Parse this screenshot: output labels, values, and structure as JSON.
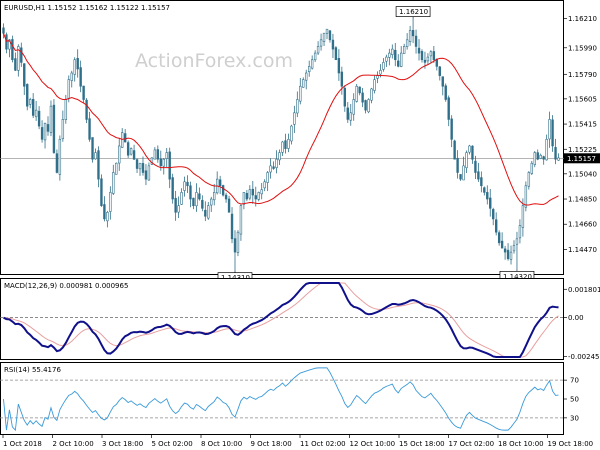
{
  "header": {
    "main": "EURUSD,H1  1.15152 1.15162 1.15122 1.15157",
    "macd": "MACD(12,26,9) 0.000981 0.000965",
    "rsi": "RSI(14) 55.4176"
  },
  "watermark": "ActionForex.com",
  "colors": {
    "candle": "#2f6f8a",
    "ma": "#e01010",
    "macd_line": "#10108a",
    "macd_signal": "#e8a0a0",
    "rsi_line": "#3a9ad9",
    "grid_dash": "#999999",
    "current_price_line": "#888888"
  },
  "chart_data": [
    {
      "type": "candlestick",
      "symbol": "EURUSD",
      "timeframe": "H1",
      "ylim": [
        1.143,
        1.1632
      ],
      "y_ticks": [
        "1.16210",
        "1.15990",
        "1.15790",
        "1.15605",
        "1.15415",
        "1.15225",
        "1.15157",
        "1.15040",
        "1.14850",
        "1.14660",
        "1.14470"
      ],
      "current_price": "1.15157",
      "annotations": [
        {
          "label": "1.16210",
          "value": 1.1621,
          "index": 138
        },
        {
          "label": "1.14310",
          "value": 1.1431,
          "index": 78
        },
        {
          "label": "1.14320",
          "value": 1.1432,
          "index": 173
        }
      ],
      "x_labels": [
        "1 Oct 2018",
        "2 Oct 10:00",
        "3 Oct 18:00",
        "5 Oct 02:00",
        "8 Oct 10:00",
        "9 Oct 18:00",
        "11 Oct 02:00",
        "12 Oct 10:00",
        "15 Oct 18:00",
        "17 Oct 02:00",
        "18 Oct 10:00",
        "19 Oct 18:00"
      ],
      "closes": [
        1.161,
        1.1598,
        1.1605,
        1.159,
        1.1582,
        1.16,
        1.1588,
        1.157,
        1.1555,
        1.156,
        1.1548,
        1.1552,
        1.154,
        1.153,
        1.1542,
        1.1536,
        1.1555,
        1.152,
        1.1505,
        1.153,
        1.1545,
        1.156,
        1.1575,
        1.158,
        1.159,
        1.1583,
        1.157,
        1.156,
        1.1545,
        1.153,
        1.1515,
        1.152,
        1.15,
        1.148,
        1.147,
        1.1475,
        1.149,
        1.1505,
        1.1512,
        1.1525,
        1.1535,
        1.1528,
        1.1518,
        1.1523,
        1.1515,
        1.1508,
        1.1512,
        1.1505,
        1.15,
        1.151,
        1.1516,
        1.1522,
        1.1515,
        1.151,
        1.1515,
        1.152,
        1.15,
        1.1485,
        1.1475,
        1.148,
        1.149,
        1.1498,
        1.1495,
        1.1485,
        1.148,
        1.149,
        1.1485,
        1.1478,
        1.1472,
        1.148,
        1.1485,
        1.149,
        1.15,
        1.1495,
        1.1488,
        1.1485,
        1.1475,
        1.1455,
        1.1445,
        1.146,
        1.148,
        1.149,
        1.1485,
        1.1492,
        1.1488,
        1.1485,
        1.149,
        1.1492,
        1.1498,
        1.1505,
        1.151,
        1.1508,
        1.1515,
        1.152,
        1.1528,
        1.1523,
        1.153,
        1.154,
        1.155,
        1.156,
        1.157,
        1.1575,
        1.158,
        1.1585,
        1.159,
        1.1595,
        1.16,
        1.1605,
        1.161,
        1.1613,
        1.1605,
        1.1598,
        1.159,
        1.158,
        1.157,
        1.1555,
        1.1545,
        1.155,
        1.156,
        1.157,
        1.1565,
        1.1558,
        1.1552,
        1.156,
        1.1568,
        1.1575,
        1.1578,
        1.1582,
        1.1588,
        1.1592,
        1.1595,
        1.1598,
        1.159,
        1.1585,
        1.1595,
        1.16,
        1.1605,
        1.1612,
        1.1608,
        1.16,
        1.1595,
        1.159,
        1.1588,
        1.1592,
        1.1596,
        1.159,
        1.1585,
        1.1578,
        1.157,
        1.156,
        1.1545,
        1.153,
        1.1515,
        1.1505,
        1.15,
        1.151,
        1.152,
        1.1525,
        1.1515,
        1.1505,
        1.15,
        1.1495,
        1.149,
        1.1485,
        1.1478,
        1.147,
        1.146,
        1.1452,
        1.1448,
        1.1445,
        1.144,
        1.1445,
        1.145,
        1.1455,
        1.1465,
        1.148,
        1.1495,
        1.1505,
        1.1512,
        1.152,
        1.1515,
        1.1518,
        1.1515,
        1.153,
        1.1545,
        1.1525,
        1.1515,
        1.1516
      ],
      "ma_period": 24
    },
    {
      "type": "line",
      "indicator": "MACD",
      "params": "12,26,9",
      "ylim": [
        -0.0025,
        0.0022
      ],
      "y_ticks": [
        "0.001801",
        "0.00",
        "-0.002458"
      ],
      "zero_line": 0
    },
    {
      "type": "line",
      "indicator": "RSI",
      "period": 14,
      "ylim": [
        15,
        85
      ],
      "y_ticks": [
        "70",
        "50",
        "30"
      ],
      "levels": [
        70,
        30
      ]
    }
  ]
}
